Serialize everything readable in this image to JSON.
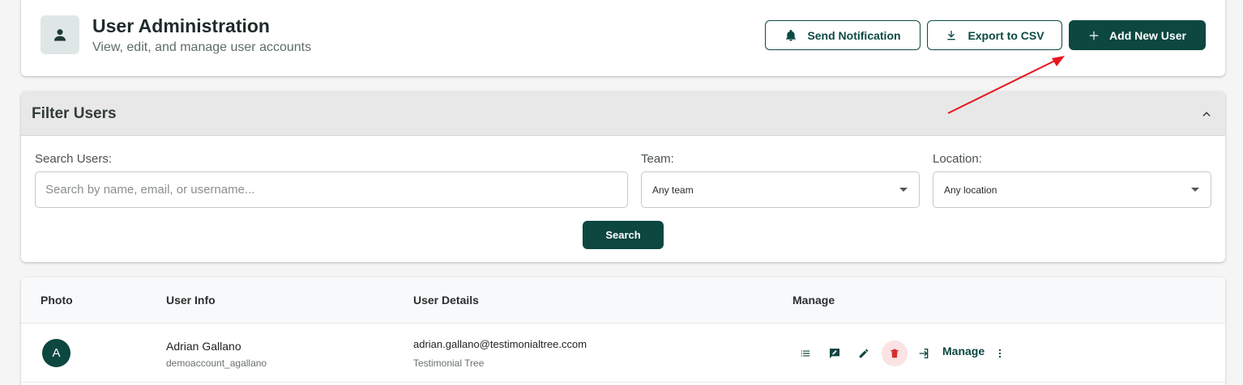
{
  "header": {
    "title": "User Administration",
    "subtitle": "View, edit, and manage user accounts",
    "icon": "person-icon",
    "actions": {
      "send_notification": "Send Notification",
      "export_csv": "Export to CSV",
      "add_user": "Add New User"
    }
  },
  "filters": {
    "title": "Filter Users",
    "search": {
      "label": "Search Users:",
      "placeholder": "Search by name, email, or username...",
      "value": ""
    },
    "team": {
      "label": "Team:",
      "selected": "Any team"
    },
    "location": {
      "label": "Location:",
      "selected": "Any location"
    },
    "search_button": "Search"
  },
  "table": {
    "columns": [
      "Photo",
      "User Info",
      "User Details",
      "Manage"
    ],
    "rows": [
      {
        "avatar_initial": "A",
        "name": "Adrian Gallano",
        "username": "demoaccount_agallano",
        "email": "adrian.gallano@testimonialtree.ccom",
        "company": "Testimonial Tree",
        "manage_label": "Manage"
      }
    ]
  },
  "colors": {
    "primary": "#0c4740",
    "annotation_arrow": "#e8151b",
    "delete_bg": "#fbe3e3",
    "delete_icon": "#d32f2f"
  }
}
